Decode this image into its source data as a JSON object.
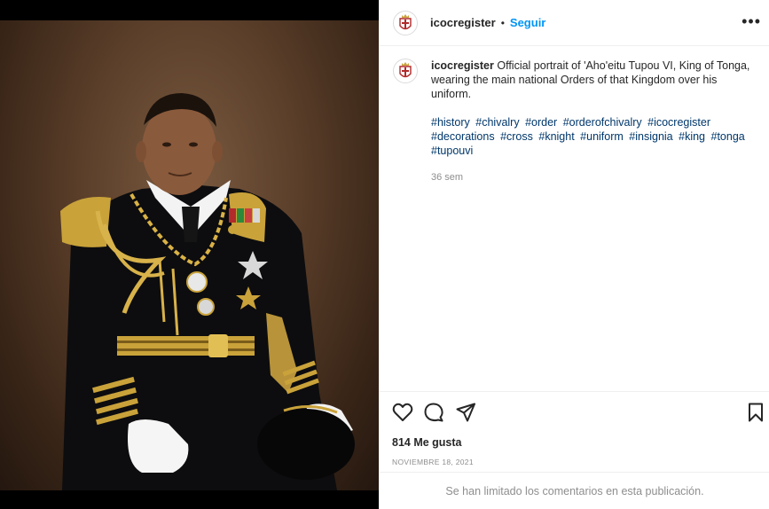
{
  "post": {
    "username": "icocregister",
    "follow_label": "Seguir",
    "separator": "•",
    "more_label": "•••",
    "caption_text": "Official portrait of 'Aho'eitu Tupou VI, King of Tonga, wearing the main national Orders of that Kingdom over his uniform.",
    "hashtags": [
      "#history",
      "#chivalry",
      "#order",
      "#orderofchivalry",
      "#icocregister",
      "#decorations",
      "#cross",
      "#knight",
      "#uniform",
      "#insignia",
      "#king",
      "#tonga",
      "#tupouvi"
    ],
    "age": "36 sem",
    "likes": "814 Me gusta",
    "date": "NOVIEMBRE 18, 2021",
    "comments_limited": "Se han limitado los comentarios en esta publicación."
  },
  "icons": {
    "like": "heart-icon",
    "comment": "comment-icon",
    "share": "share-icon",
    "save": "bookmark-icon",
    "avatar": "crest-icon"
  },
  "colors": {
    "link_blue": "#0095f6",
    "hashtag": "#00376b",
    "muted": "#8e8e8e",
    "text": "#262626",
    "border": "#efefef"
  }
}
